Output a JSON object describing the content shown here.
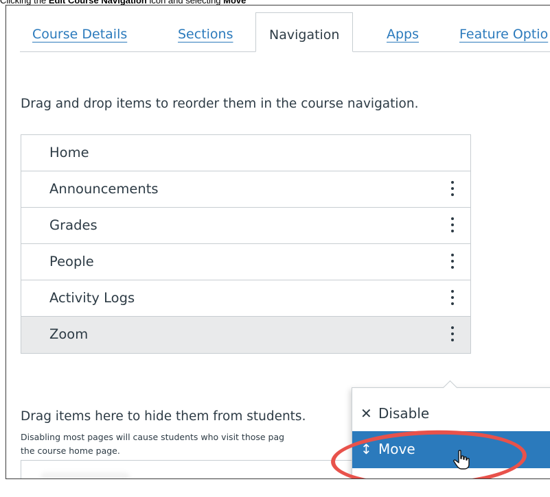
{
  "caption": {
    "prefix": "Clicking the ",
    "bold1": "Edit Course Navigation",
    "middle": " icon and selecting ",
    "bold2": "Move"
  },
  "tabs": [
    {
      "label": "Course Details",
      "active": false
    },
    {
      "label": "Sections",
      "active": false
    },
    {
      "label": "Navigation",
      "active": true
    },
    {
      "label": "Apps",
      "active": false
    },
    {
      "label": "Feature Optio",
      "active": false
    }
  ],
  "instructions": "Drag and drop items to reorder them in the course navigation.",
  "nav_items": [
    {
      "label": "Home"
    },
    {
      "label": "Announcements"
    },
    {
      "label": "Grades"
    },
    {
      "label": "People"
    },
    {
      "label": "Activity Logs"
    },
    {
      "label": "Zoom"
    }
  ],
  "hidden_section": {
    "title": "Drag items here to hide them from students.",
    "note_line1": "Disabling most pages will cause students who visit those pag",
    "note_line2": "the course home page."
  },
  "menu": {
    "disable_icon": "✕",
    "disable_label": "Disable",
    "move_icon": "↕",
    "move_label": "Move"
  },
  "colors": {
    "link": "#2b7abc",
    "text": "#2d3b45",
    "menu_highlight": "#2b7abc",
    "annotation_oval": "#e8524b",
    "row_highlight": "#e9eaeb"
  },
  "icons": {
    "kebab": "kebab-menu-icon",
    "cursor": "hand-pointer-icon"
  }
}
